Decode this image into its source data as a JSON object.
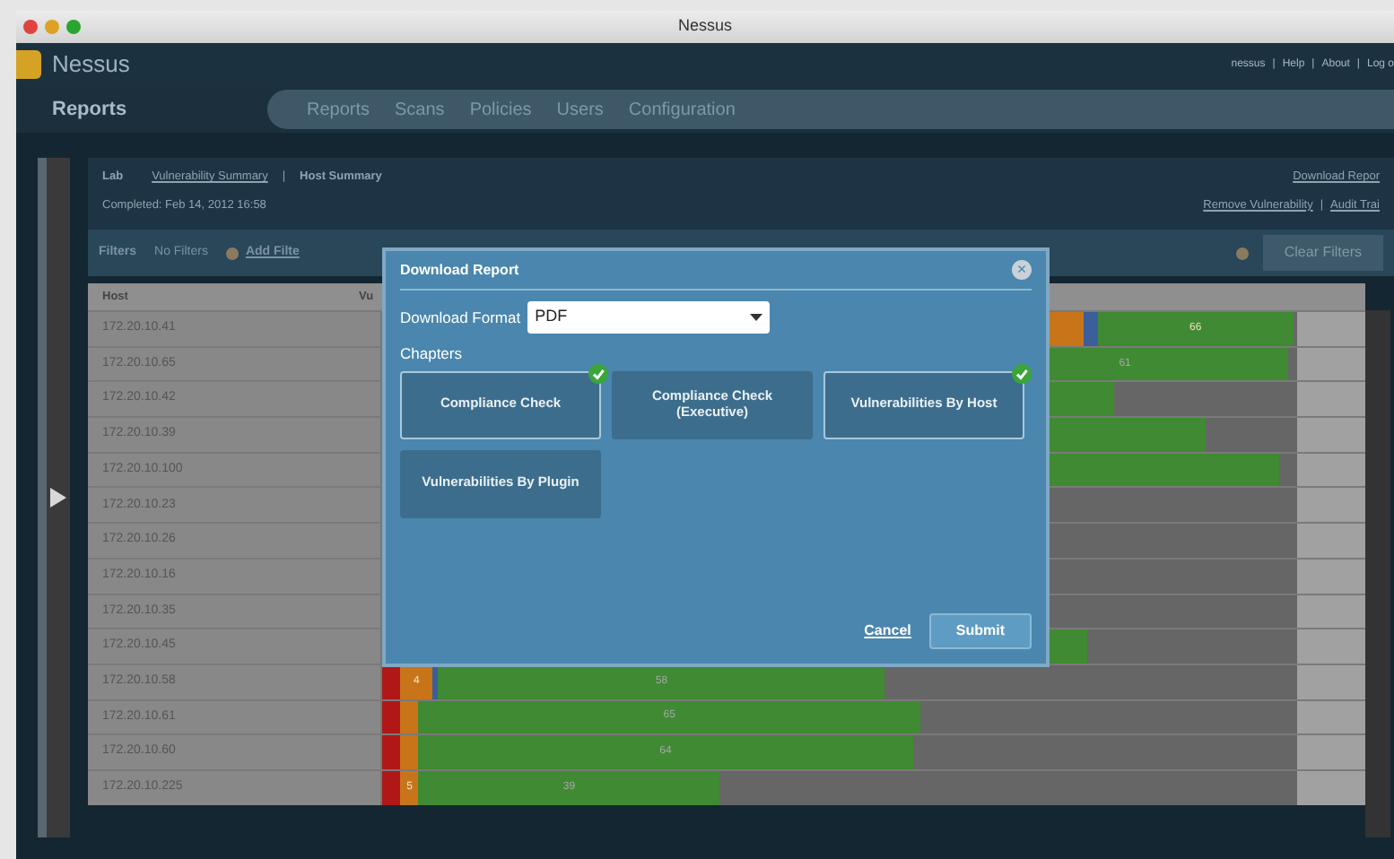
{
  "window": {
    "title": "Nessus"
  },
  "header": {
    "logo": "Nessus",
    "separator": "|",
    "user_links": [
      "nessus",
      "Help",
      "About",
      "Log o"
    ]
  },
  "section_title": "Reports",
  "nav_tabs": [
    "Reports",
    "Scans",
    "Policies",
    "Users",
    "Configuration"
  ],
  "report": {
    "name": "Lab",
    "breadcrumb_link": "Vulnerability Summary",
    "separator": "|",
    "current": "Host Summary",
    "completed": "Completed: Feb 14, 2012 16:58",
    "download_link": "Download Repor",
    "action_links": [
      "Remove Vulnerability",
      "Audit Trai"
    ]
  },
  "filters": {
    "label": "Filters",
    "value": "No Filters",
    "add": "Add Filte",
    "clear": "Clear Filters"
  },
  "table": {
    "columns": [
      "Host",
      "Vu"
    ],
    "rows": [
      {
        "host": "172.20.10.41",
        "bar": {
          "level": 0.996,
          "color": "#c8751a",
          "segments": [
            {
              "color": "#3a5f9a",
              "level": 0.015
            },
            {
              "color": "#3f8a32",
              "level": 0.215,
              "label": "66"
            }
          ]
        }
      },
      {
        "host": "172.20.10.65",
        "bar": {
          "level": 0.991,
          "color": "#3f8a32",
          "label": "61"
        }
      },
      {
        "host": "172.20.10.42",
        "bar": {
          "level": 0.8,
          "color": "#3f8a32"
        }
      },
      {
        "host": "172.20.10.39",
        "bar": {
          "level": 0.9,
          "color": "#3f8a32"
        }
      },
      {
        "host": "172.20.10.100",
        "bar": {
          "level": 0.98,
          "color": "#3f8a32"
        }
      },
      {
        "host": "172.20.10.23"
      },
      {
        "host": "172.20.10.26"
      },
      {
        "host": "172.20.10.16"
      },
      {
        "host": "172.20.10.35"
      },
      {
        "host": "172.20.10.45",
        "bar": {
          "level": 0.77,
          "color": "#3f8a32"
        }
      },
      {
        "host": "172.20.10.58",
        "bar": {
          "color": "#3f8a32",
          "label": "58",
          "segments": [
            {
              "color": "#b01818",
              "level": 0.02
            },
            {
              "color": "#c8751a",
              "level": 0.035,
              "label": "4"
            },
            {
              "color": "#3a5f9a"
            }
          ]
        }
      },
      {
        "host": "172.20.10.61",
        "bar": {
          "color": "#3f8a32",
          "label": "65",
          "segments": [
            {
              "color": "#b01818",
              "level": 0.02
            },
            {
              "color": "#c8751a",
              "level": 0.02
            }
          ]
        }
      },
      {
        "host": "172.20.10.60",
        "bar": {
          "color": "#3f8a32",
          "label": "64",
          "segments": [
            {
              "color": "#b01818",
              "level": 0.02
            },
            {
              "color": "#c8751a",
              "level": 0.02
            }
          ]
        }
      },
      {
        "host": "172.20.10.225",
        "bar": {
          "color": "#3f8a32",
          "label": "39",
          "segments": [
            {
              "color": "#b01818",
              "level": 0.02
            },
            {
              "color": "#c8751a",
              "level": 0.02,
              "label": "5"
            }
          ]
        }
      }
    ]
  },
  "dialog": {
    "title": "Download Report",
    "close": "×",
    "format_label": "Download Format",
    "format_value": "PDF",
    "chapters_label": "Chapters",
    "chapters": [
      {
        "label": "Compliance Check",
        "selected": true
      },
      {
        "label": "Compliance Check (Executive)",
        "selected": false
      },
      {
        "label": "Vulnerabilities By Host",
        "selected": true
      },
      {
        "label": "Vulnerabilities By Plugin",
        "selected": false
      }
    ],
    "cancel": "Cancel",
    "submit": "Submit"
  }
}
